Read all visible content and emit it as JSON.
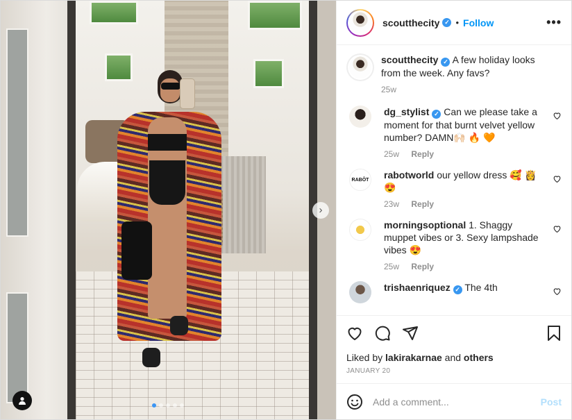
{
  "header": {
    "username": "scoutthecity",
    "separator": "•",
    "follow_label": "Follow",
    "more_label": "•••"
  },
  "caption": {
    "username": "scoutthecity",
    "text": "A few holiday looks from the week. Any favs?",
    "time": "25w"
  },
  "comments": [
    {
      "username": "dg_stylist",
      "verified": true,
      "text": "Can we please take a moment for that burnt velvet yellow number? DAMN🙌🏻 🔥 🧡",
      "time": "25w",
      "reply_label": "Reply",
      "avatar": "stylist-avatar"
    },
    {
      "username": "rabotworld",
      "verified": false,
      "text": "our yellow dress 🥰 👸 😍",
      "time": "23w",
      "reply_label": "Reply",
      "avatar_text": "RABÔT"
    },
    {
      "username": "morningsoptional",
      "verified": false,
      "text": "1. Shaggy muppet vibes or 3. Sexy lampshade vibes 😍",
      "time": "25w",
      "reply_label": "Reply",
      "avatar": "sun-logo-avatar"
    },
    {
      "username": "trishaenriquez",
      "verified": true,
      "text": "The 4th",
      "time": "",
      "reply_label": "",
      "avatar": "person-avatar"
    }
  ],
  "likes": {
    "prefix": "Liked by",
    "user": "lakirakarnae",
    "joiner": "and",
    "others": "others"
  },
  "date": "JANUARY 20",
  "add_comment": {
    "placeholder": "Add a comment...",
    "post_label": "Post"
  },
  "carousel": {
    "total": 5,
    "active_index": 0,
    "next_label": "›"
  },
  "colors": {
    "accent": "#0095f6",
    "verified": "#3897f0",
    "post_disabled": "#b2dffc",
    "meta_gray": "#8e8e8e"
  },
  "icons": [
    "verified-icon",
    "more-icon",
    "heart-icon",
    "comment-icon",
    "share-icon",
    "bookmark-icon",
    "emoji-icon",
    "user-tag-icon",
    "chevron-right-icon"
  ]
}
